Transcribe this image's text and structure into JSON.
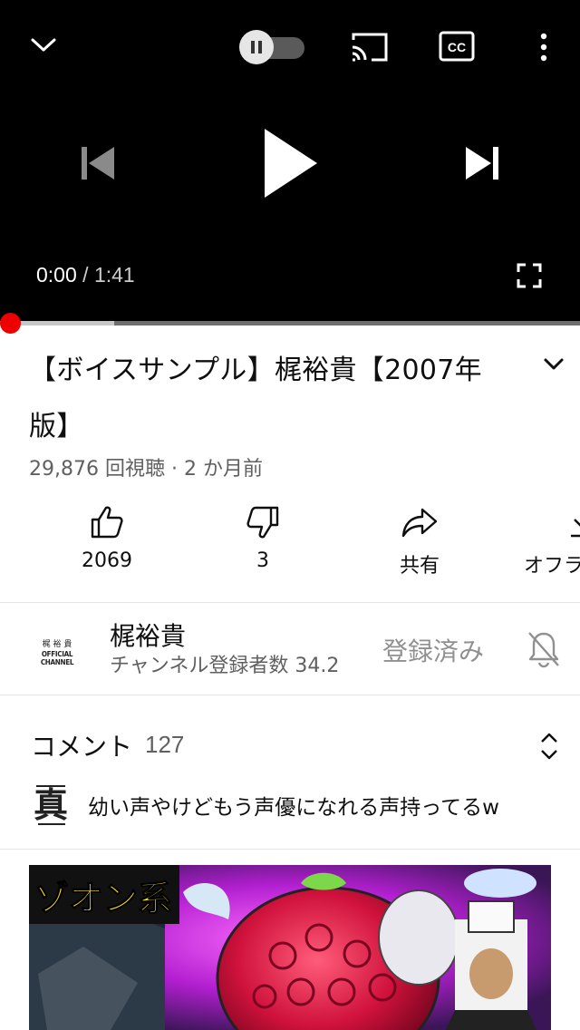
{
  "player": {
    "current_time": "0:00",
    "separator": " / ",
    "duration": "1:41",
    "progress_fraction": 0.197,
    "accent_color": "#ee0000"
  },
  "video": {
    "title": "【ボイスサンプル】梶裕貴【2007年版】",
    "meta": "29,876 回視聴 · 2 か月前"
  },
  "actions": {
    "like_count": "2069",
    "dislike_count": "3",
    "share_label": "共有",
    "offline_label": "オフラ"
  },
  "channel": {
    "logo_line1": "梶 裕 貴",
    "logo_line2": "OFFICIAL CHANNEL",
    "name": "梶裕貴",
    "subscribers": "チャンネル登録者数 34.2",
    "subscribed_label": "登録済み"
  },
  "comments": {
    "heading": "コメント",
    "count": "127",
    "avatar_glyph": "真",
    "top_comment": "幼い声やけどもう声優になれる声持ってるw"
  },
  "next_video": {
    "thumbnail_text": "ゾオン系"
  },
  "icons": [
    "chevron-down-icon",
    "pause-icon",
    "cast-icon",
    "cc-icon",
    "more-vert-icon",
    "skip-previous-icon",
    "play-icon",
    "skip-next-icon",
    "fullscreen-icon",
    "thumb-up-icon",
    "thumb-down-icon",
    "share-icon",
    "download-icon",
    "bell-off-icon",
    "unfold-icon"
  ]
}
